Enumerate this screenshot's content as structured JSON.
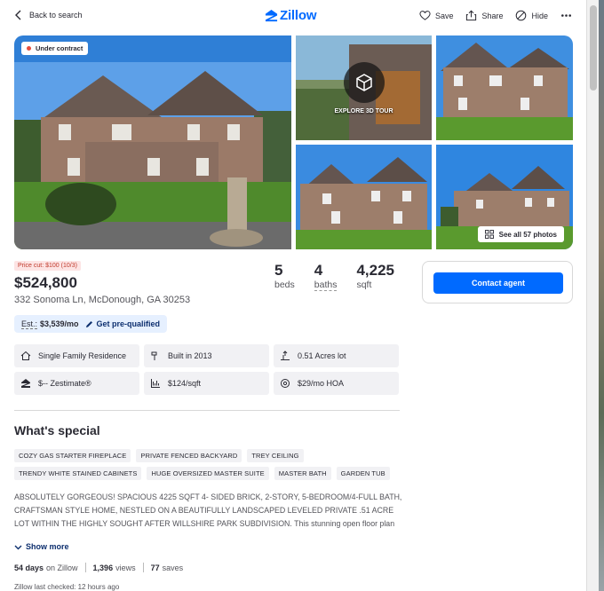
{
  "topbar": {
    "back_label": "Back to search",
    "logo_text": "Zillow",
    "save_label": "Save",
    "share_label": "Share",
    "hide_label": "Hide"
  },
  "gallery": {
    "status_badge": "Under contract",
    "tour_label": "EXPLORE 3D TOUR",
    "see_all_label": "See all 57 photos"
  },
  "listing": {
    "price_cut": "Price cut: $100 (10/3)",
    "price": "$524,800",
    "address": "332 Sonoma Ln, McDonough, GA 30253",
    "facts": [
      {
        "value": "5",
        "label": "beds"
      },
      {
        "value": "4",
        "label": "baths"
      },
      {
        "value": "4,225",
        "label": "sqft"
      }
    ],
    "estimate_prefix": "Est.:",
    "estimate_value": "$3,539/mo",
    "prequalify_label": "Get pre-qualified"
  },
  "contact": {
    "button_label": "Contact agent"
  },
  "chips": [
    {
      "icon": "house-icon",
      "text": "Single Family Residence"
    },
    {
      "icon": "hammer-icon",
      "text": "Built in 2013"
    },
    {
      "icon": "lot-icon",
      "text": "0.51 Acres lot"
    },
    {
      "icon": "zestimate-icon",
      "text": "$-- Zestimate®"
    },
    {
      "icon": "ruler-icon",
      "text": "$124/sqft"
    },
    {
      "icon": "hoa-icon",
      "text": "$29/mo HOA"
    }
  ],
  "special": {
    "heading": "What's special",
    "tags": [
      "COZY GAS STARTER FIREPLACE",
      "PRIVATE FENCED BACKYARD",
      "TREY CEILING",
      "TRENDY WHITE STAINED CABINETS",
      "HUGE OVERSIZED MASTER SUITE",
      "MASTER BATH",
      "GARDEN TUB"
    ],
    "description": "ABSOLUTELY GORGEOUS! SPACIOUS 4225 SQFT 4- SIDED BRICK, 2-STORY, 5-BEDROOM/4-FULL BATH, CRAFTSMAN STYLE HOME, NESTLED ON A BEAUTIFULLY LANDSCAPED LEVELED PRIVATE .51 ACRE LOT WITHIN THE HIGHLY SOUGHT AFTER WILLSHIRE PARK SUBDIVISION. This stunning open floor plan home comes with all the bells and whistles. Natural wood floors, 2-story vaulted ceiling foyer. The Gourmet Chef",
    "show_more": "Show more"
  },
  "stats": {
    "days_value": "54 days",
    "days_label": "on Zillow",
    "views_value": "1,396",
    "views_label": "views",
    "saves_value": "77",
    "saves_label": "saves",
    "last_checked": "Zillow last checked: 12 hours ago"
  },
  "colors": {
    "brand": "#006aff",
    "price_cut_bg": "#fde4e4",
    "price_cut_text": "#c0392b",
    "estimate_bg": "#e6f0ff"
  }
}
